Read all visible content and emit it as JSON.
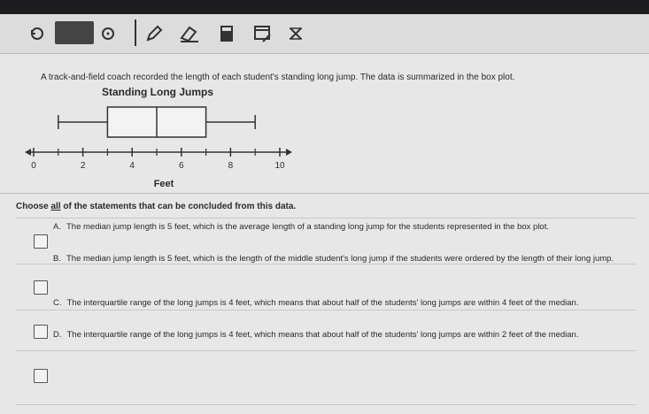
{
  "prompt": "A track-and-field coach recorded the length of each student's standing long jump. The data is summarized in the box plot.",
  "chart_data": {
    "type": "boxplot",
    "title": "Standing Long Jumps",
    "xlabel": "Feet",
    "xlim": [
      0,
      10
    ],
    "ticks": [
      0,
      2,
      4,
      6,
      8,
      10
    ],
    "tick_labels": [
      "0",
      "2",
      "4",
      "6",
      "8",
      "10"
    ],
    "minor_ticks": [
      1,
      3,
      5,
      7,
      9
    ],
    "min": 1,
    "q1": 3,
    "median": 5,
    "q3": 7,
    "max": 9
  },
  "instruction": {
    "before": "Choose ",
    "underlined": "all",
    "after": " of the statements that can be concluded from this data."
  },
  "choices": [
    {
      "letter": "A.",
      "text": "The median jump length is 5 feet, which is the average length of a standing long jump for the students represented in the box plot."
    },
    {
      "letter": "B.",
      "text": "The median jump length is 5 feet, which is the length of the middle student's long jump if the students were ordered by the length of their long jump."
    },
    {
      "letter": "C.",
      "text": "The interquartile range of the long jumps is 4 feet, which means that about half of the students' long jumps are within 4 feet of the median."
    },
    {
      "letter": "D.",
      "text": "The interquartile range of the long jumps is 4 feet, which means that about half of the students' long jumps are within 2 feet of the median."
    }
  ],
  "toolbar": {
    "icons": [
      "reload-icon",
      "dark-button",
      "timer-icon",
      "pen-icon",
      "eraser-icon",
      "calculator-icon",
      "notepad-icon",
      "close-x-icon"
    ]
  }
}
